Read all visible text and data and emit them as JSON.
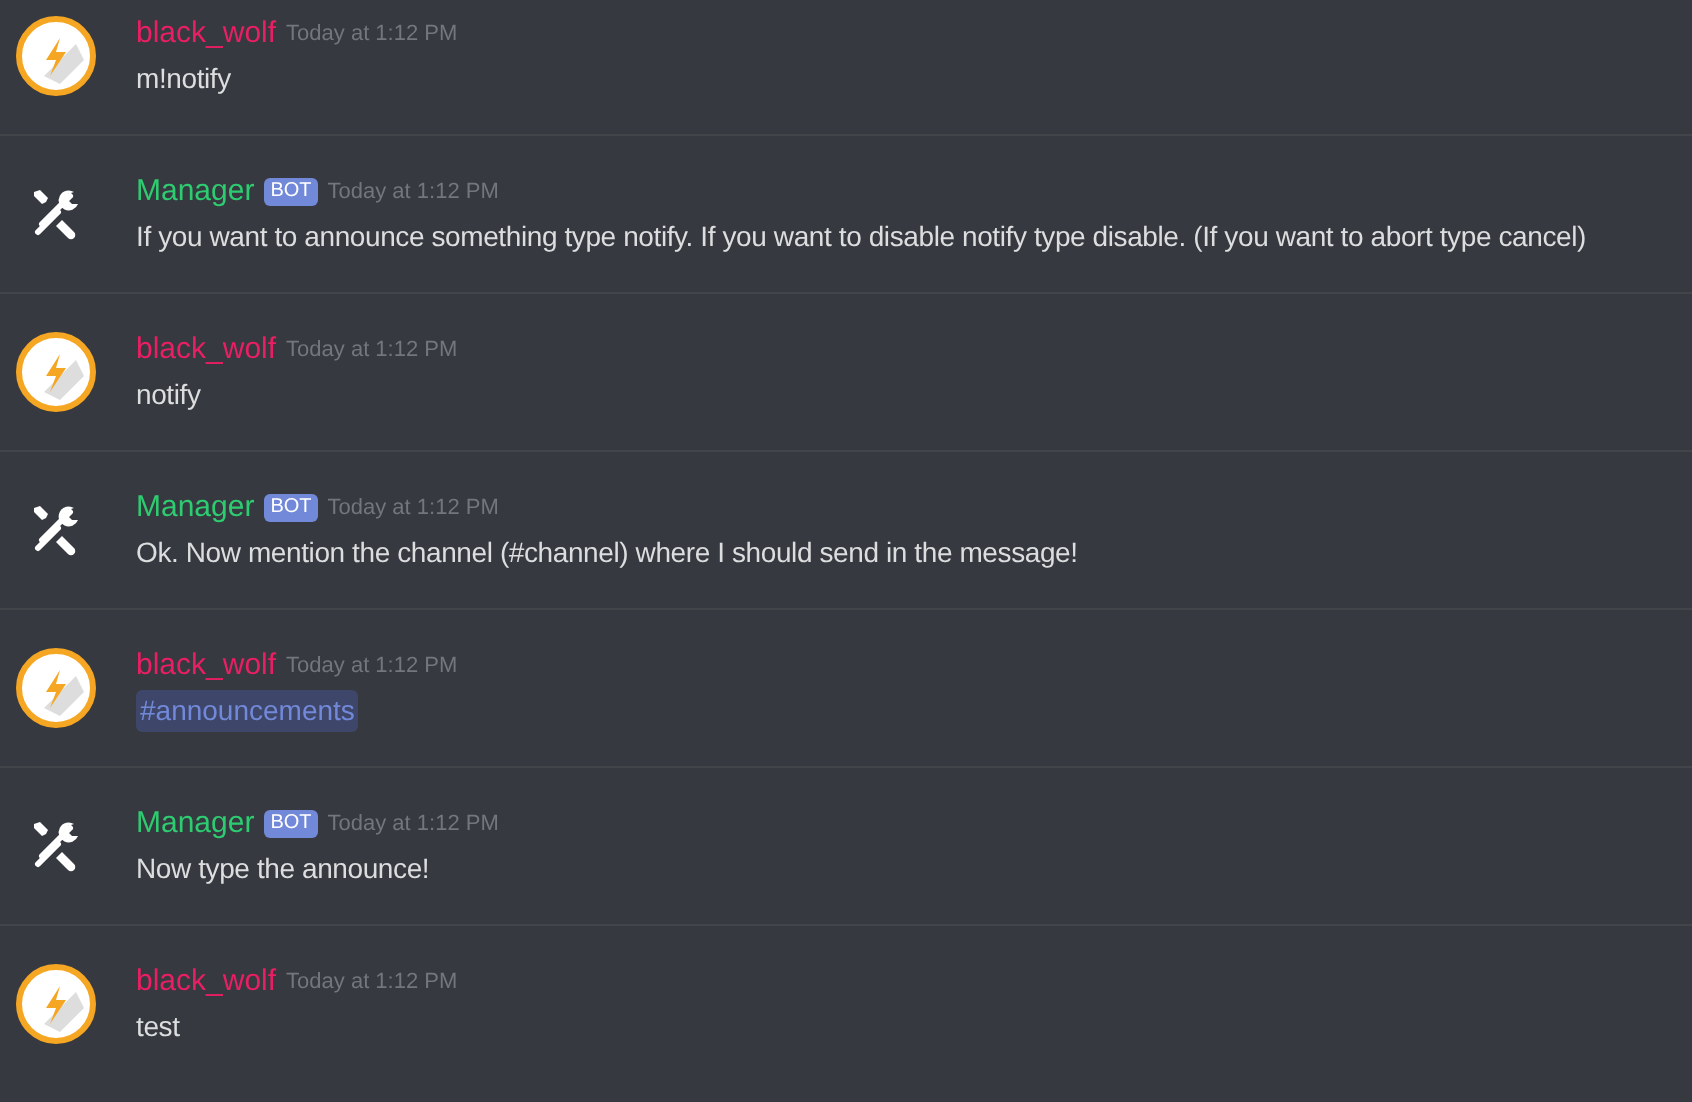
{
  "messages": [
    {
      "kind": "user",
      "author": "black_wolf",
      "color": "#e91e63",
      "timestamp": "Today at 1:12 PM",
      "text": "m!notify"
    },
    {
      "kind": "bot",
      "author": "Manager",
      "color": "#2ecc71",
      "badge": "BOT",
      "timestamp": "Today at 1:12 PM",
      "text": "If you want to announce something type notify. If you want to disable notify type disable. (If you want to abort type cancel)"
    },
    {
      "kind": "user",
      "author": "black_wolf",
      "color": "#e91e63",
      "timestamp": "Today at 1:12 PM",
      "text": "notify"
    },
    {
      "kind": "bot",
      "author": "Manager",
      "color": "#2ecc71",
      "badge": "BOT",
      "timestamp": "Today at 1:12 PM",
      "text": "Ok. Now mention the channel (#channel) where I should send in the message!"
    },
    {
      "kind": "user",
      "author": "black_wolf",
      "color": "#e91e63",
      "timestamp": "Today at 1:12 PM",
      "mention": "#announcements"
    },
    {
      "kind": "bot",
      "author": "Manager",
      "color": "#2ecc71",
      "badge": "BOT",
      "timestamp": "Today at 1:12 PM",
      "text": "Now type the announce!"
    },
    {
      "kind": "user",
      "author": "black_wolf",
      "color": "#e91e63",
      "timestamp": "Today at 1:12 PM",
      "text": "test"
    }
  ]
}
